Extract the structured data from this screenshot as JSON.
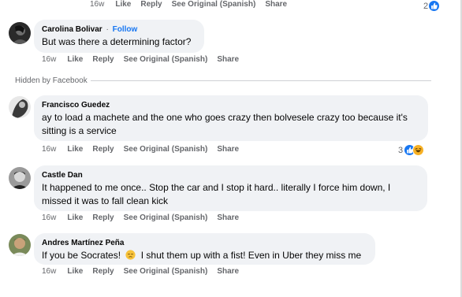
{
  "top_actions": {
    "time": "16w",
    "like": "Like",
    "reply": "Reply",
    "see_original": "See Original (Spanish)",
    "share": "Share",
    "reaction_count": "2"
  },
  "comments": [
    {
      "author": "Carolina Bolivar",
      "follow": "Follow",
      "separator": "·",
      "text": "But was there a determining factor?",
      "time": "16w",
      "like": "Like",
      "reply": "Reply",
      "see_original": "See Original (Spanish)",
      "share": "Share"
    },
    {
      "author": "Francisco Guedez",
      "text": "ay to load a machete and the one who goes crazy then bolvesele crazy too because it's sitting is a service",
      "time": "16w",
      "like": "Like",
      "reply": "Reply",
      "see_original": "See Original (Spanish)",
      "share": "Share",
      "reaction_count": "3"
    },
    {
      "author": "Castle Dan",
      "text": "It happened to me once.. Stop the car and I stop it hard.. literally I force him down, I missed it was to fall clean kick",
      "time": "16w",
      "like": "Like",
      "reply": "Reply",
      "see_original": "See Original (Spanish)",
      "share": "Share"
    },
    {
      "author": "Andres Martínez Peña",
      "text_before": "If you be Socrates!",
      "text_after": "I shut them up with a fist! Even in Uber they miss me",
      "time": "16w",
      "like": "Like",
      "reply": "Reply",
      "see_original": "See Original (Spanish)",
      "share": "Share"
    }
  ],
  "hidden_label": "Hidden by Facebook",
  "colors": {
    "accent": "#1877f2",
    "bubble": "#f0f2f5",
    "meta": "#65676b",
    "haha": "#f7b125"
  }
}
